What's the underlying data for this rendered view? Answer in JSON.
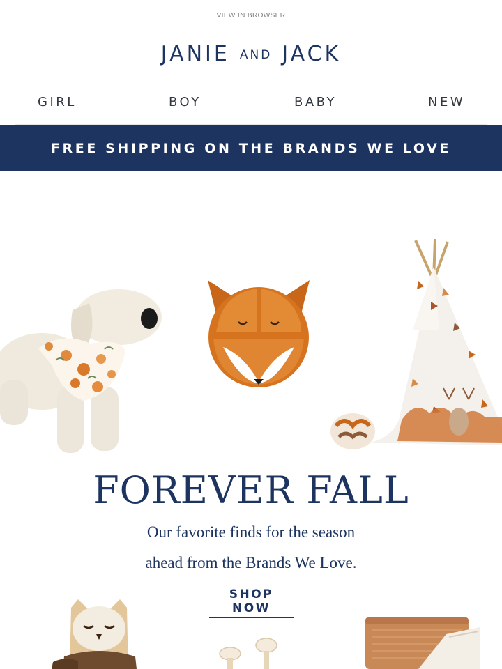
{
  "header": {
    "view_in_browser": "VIEW IN BROWSER",
    "logo_main_left": "JANIE",
    "logo_and": "AND",
    "logo_main_right": "JACK"
  },
  "nav": {
    "items": [
      {
        "label": "GIRL"
      },
      {
        "label": "BOY"
      },
      {
        "label": "BABY"
      },
      {
        "label": "NEW"
      }
    ]
  },
  "banner": {
    "text": "FREE SHIPPING ON THE BRANDS WE LOVE"
  },
  "hero": {
    "headline": "FOREVER FALL",
    "subcopy_line1": "Our favorite finds for the season",
    "subcopy_line2": "ahead from the Brands We Love.",
    "cta": "SHOP NOW",
    "products": [
      {
        "icon": "plush-dog-icon"
      },
      {
        "icon": "fox-plate-icon"
      },
      {
        "icon": "teepee-icon"
      },
      {
        "icon": "owl-toy-icon"
      },
      {
        "icon": "mushroom-toy-icon"
      },
      {
        "icon": "blanket-icon"
      }
    ]
  },
  "colors": {
    "brand_navy": "#1d3461",
    "fox_orange": "#d6731f",
    "background": "#ffffff"
  }
}
